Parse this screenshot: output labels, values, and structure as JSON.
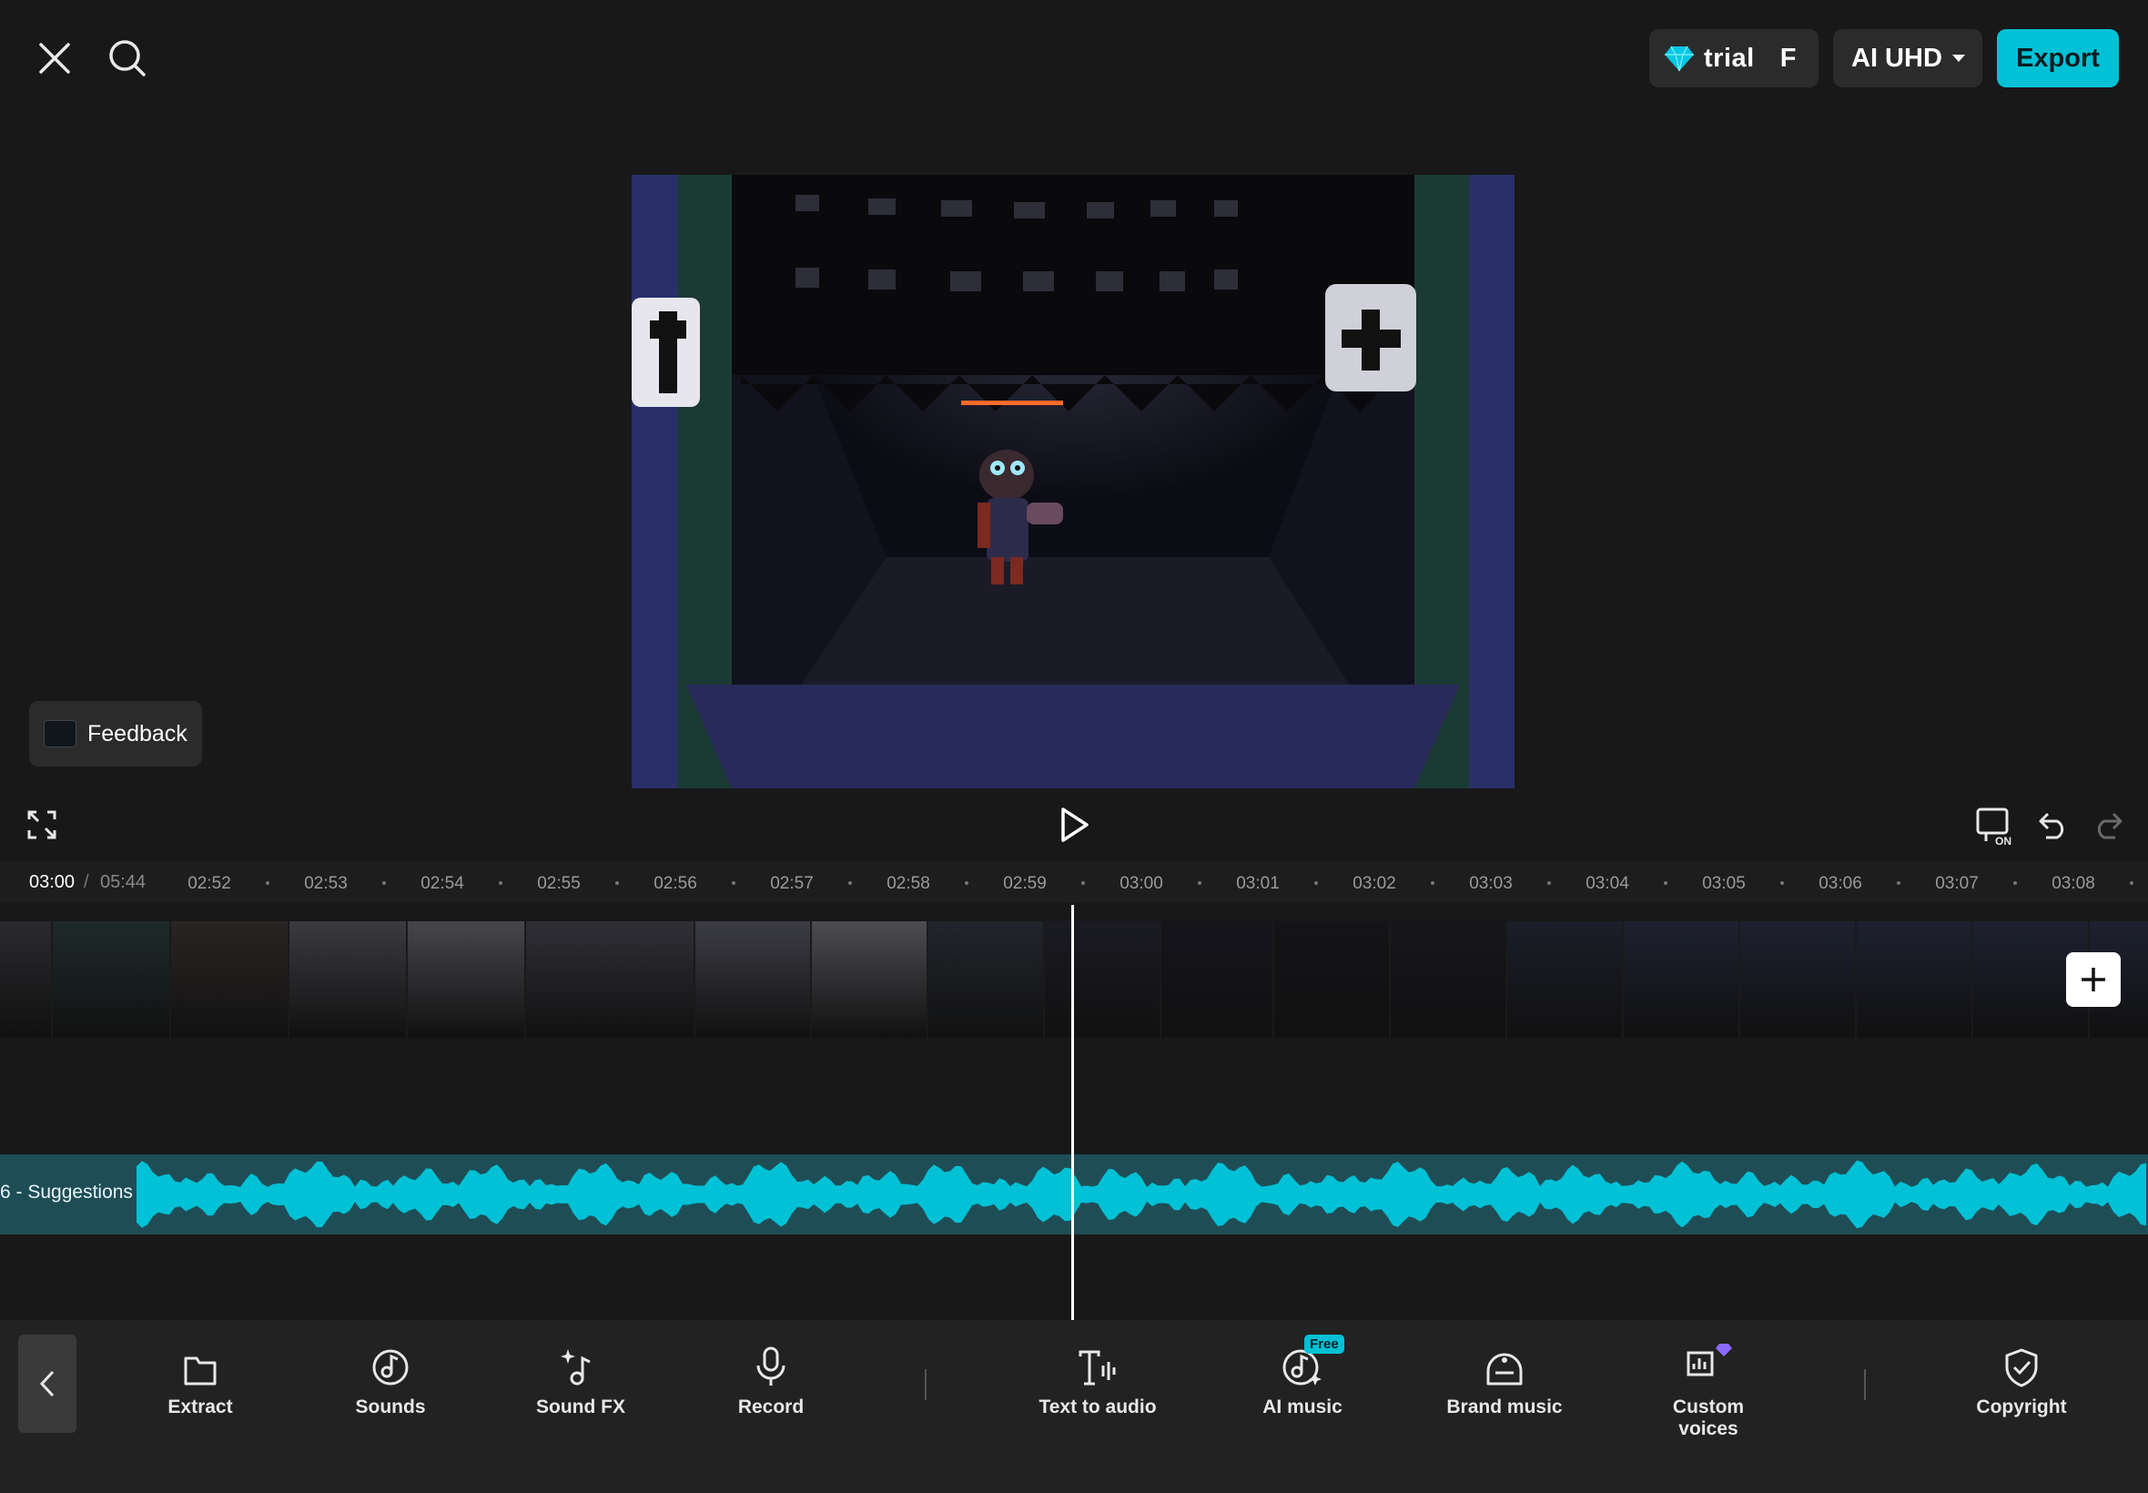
{
  "header": {
    "trial_text": "trial",
    "trial_tail": "F",
    "quality_label": "AI UHD",
    "export_label": "Export",
    "icons": {
      "close": "close-icon",
      "search": "search-icon",
      "gem": "diamond-icon",
      "caret": "caret-down-icon"
    }
  },
  "preview": {
    "feedback_label": "Feedback"
  },
  "playback": {
    "current_time": "03:00",
    "separator": "/",
    "total_time": "05:44"
  },
  "ruler": {
    "ticks": [
      "02:52",
      "02:53",
      "02:54",
      "02:55",
      "02:56",
      "02:57",
      "02:58",
      "02:59",
      "03:00",
      "03:01",
      "03:02",
      "03:03",
      "03:04",
      "03:05",
      "03:06",
      "03:07",
      "03:08"
    ]
  },
  "audio": {
    "track_label": "6 - Suggestions",
    "color": "#00c1d5"
  },
  "colors": {
    "accent": "#00c1d5",
    "background": "#181818",
    "toolbar": "#222222"
  },
  "toolbar": {
    "items": [
      {
        "label": "Extract",
        "icon": "folder-icon"
      },
      {
        "label": "Sounds",
        "icon": "music-disc-icon"
      },
      {
        "label": "Sound FX",
        "icon": "sparkle-note-icon"
      },
      {
        "label": "Record",
        "icon": "microphone-icon"
      },
      {
        "label": "Text to audio",
        "icon": "text-audio-icon"
      },
      {
        "label": "AI music",
        "icon": "ai-music-icon",
        "badge": "Free"
      },
      {
        "label": "Brand music",
        "icon": "brand-music-icon"
      },
      {
        "label": "Custom voices",
        "icon": "custom-voices-icon",
        "badge_icon": "diamond-icon"
      },
      {
        "label": "Copyright",
        "icon": "shield-check-icon"
      }
    ]
  }
}
